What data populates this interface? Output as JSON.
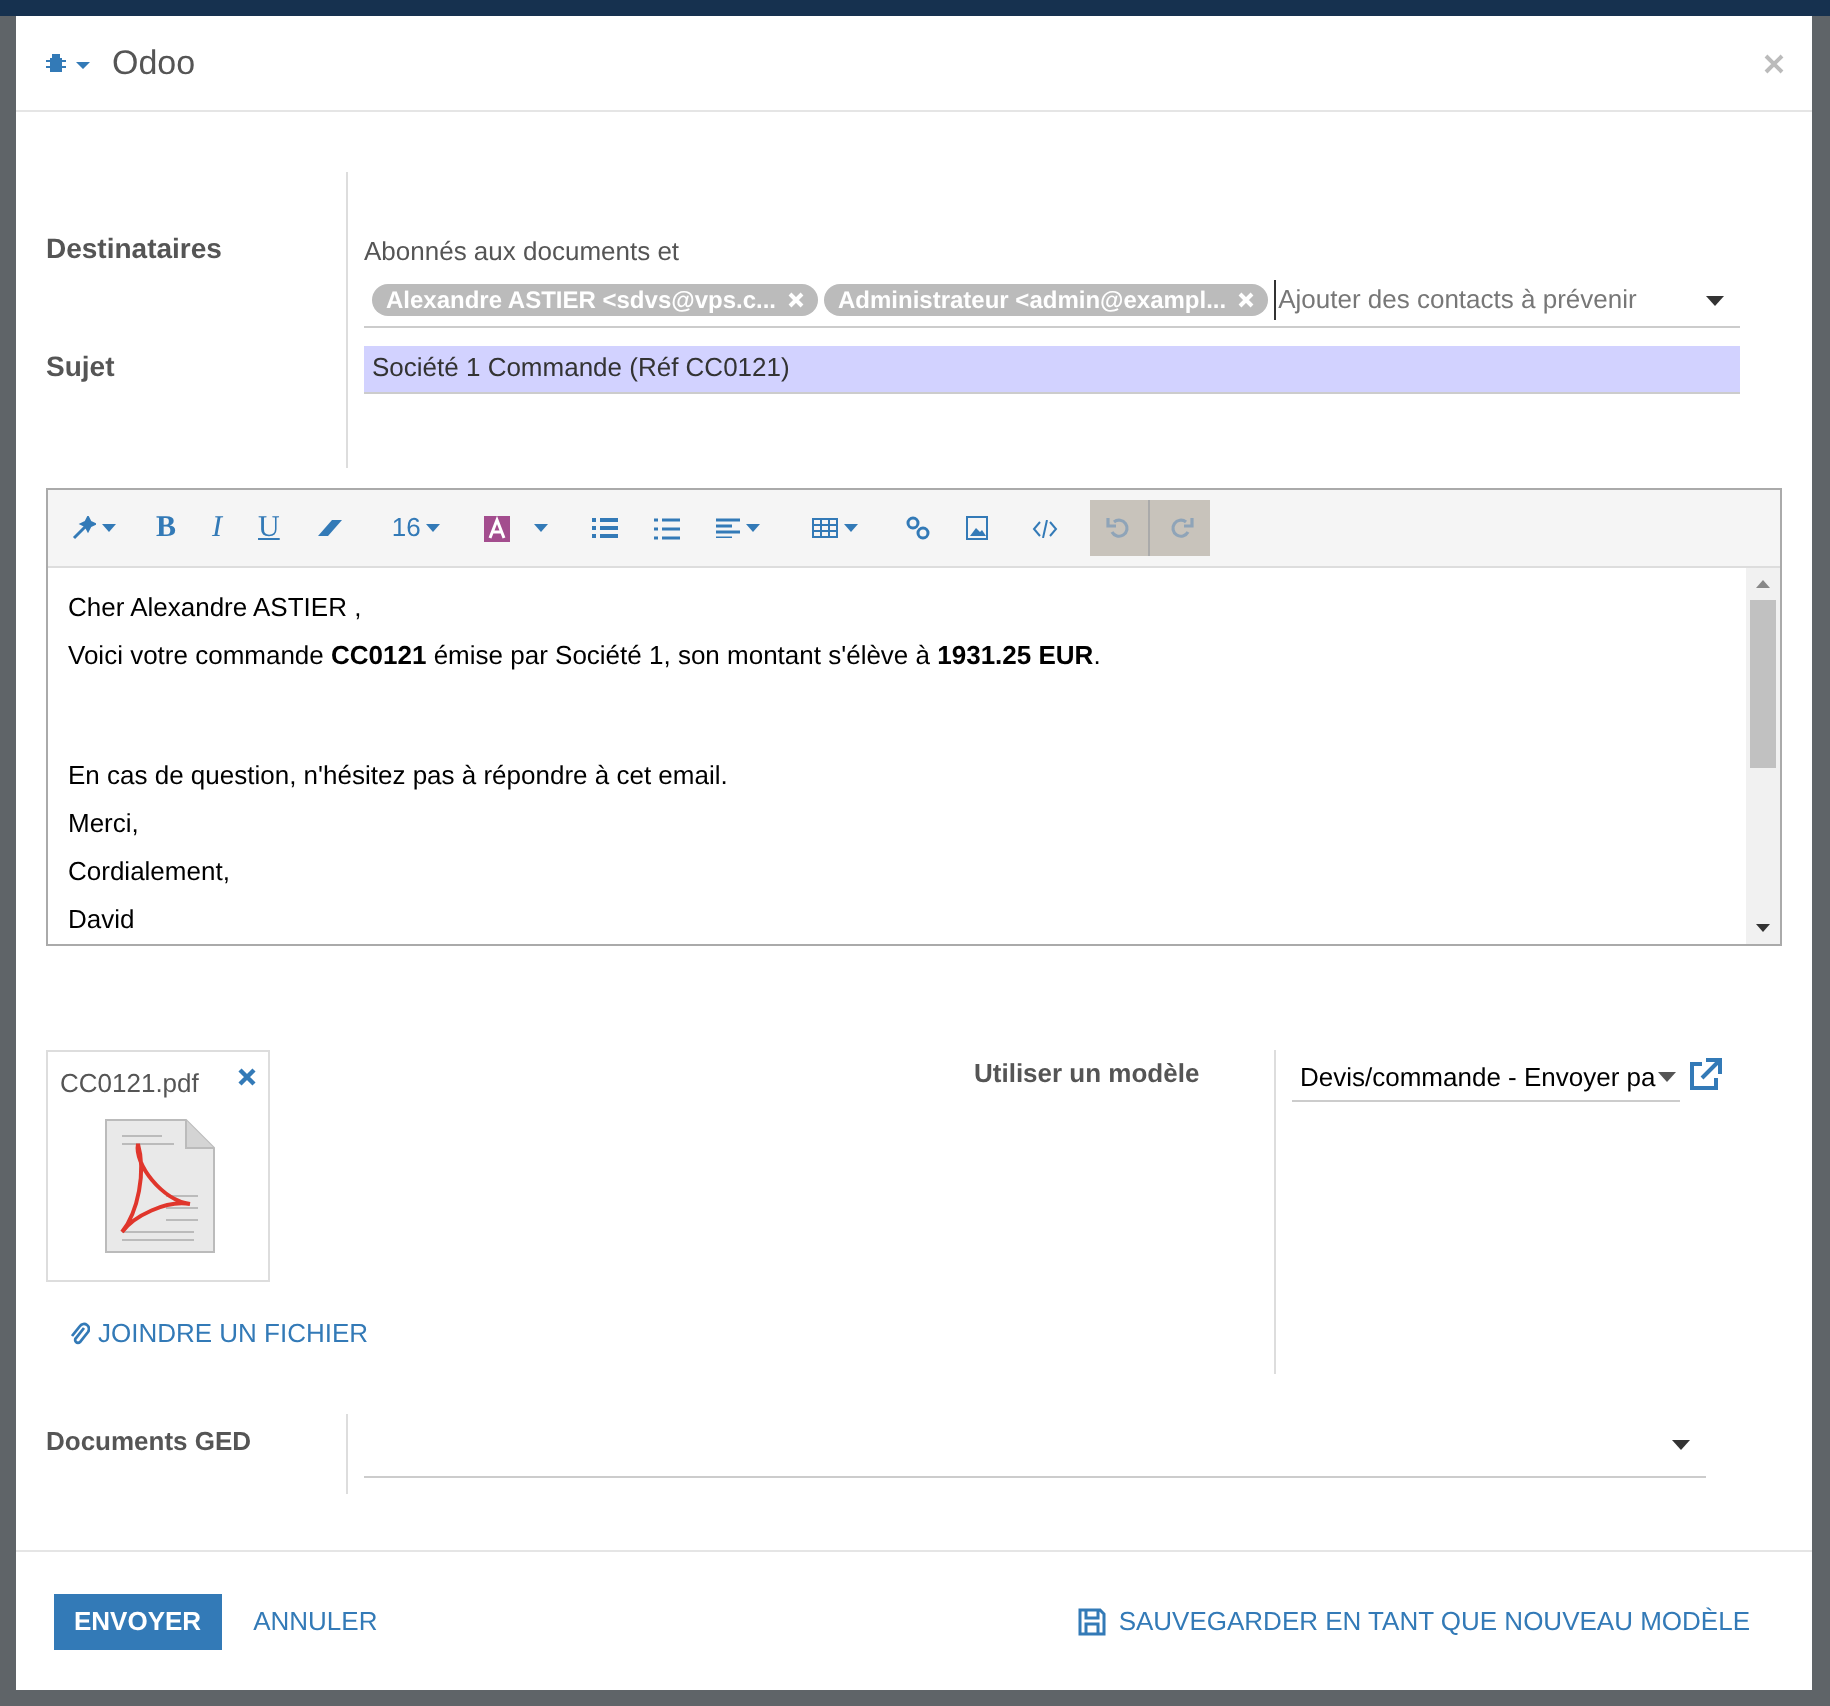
{
  "dialog": {
    "title": "Odoo"
  },
  "recipients": {
    "label": "Destinataires",
    "intro": "Abonnés aux documents et",
    "tags": [
      {
        "text": "Alexandre ASTIER <sdvs@vps.c..."
      },
      {
        "text": "Administrateur <admin@exampl..."
      }
    ],
    "placeholder": "Ajouter des contacts à prévenir"
  },
  "subject": {
    "label": "Sujet",
    "value": "Société 1 Commande (Réf CC0121)"
  },
  "editor": {
    "font_size": "16",
    "undo_disabled": true,
    "redo_disabled": true,
    "format_buttons": [
      "B",
      "I",
      "U"
    ],
    "paragraphs": [
      {
        "lines": [
          "Cher Alexandre ASTIER ,",
          "Voici votre commande **CC0121** émise par Société 1, son montant s'élève à **1931.25 EUR**."
        ]
      },
      {
        "lines": [
          "En cas de question, n'hésitez pas à répondre à cet email.",
          "Merci,",
          "Cordialement,",
          "David"
        ]
      }
    ]
  },
  "attachments": [
    {
      "name": "CC0121.pdf"
    }
  ],
  "attach_link": "JOINDRE UN FICHIER",
  "template": {
    "label": "Utiliser un modèle",
    "value": "Devis/commande - Envoyer pa"
  },
  "ged": {
    "label": "Documents GED"
  },
  "footer": {
    "send": "ENVOYER",
    "cancel": "ANNULER",
    "save_template": "SAUVEGARDER EN TANT QUE NOUVEAU MODÈLE"
  }
}
